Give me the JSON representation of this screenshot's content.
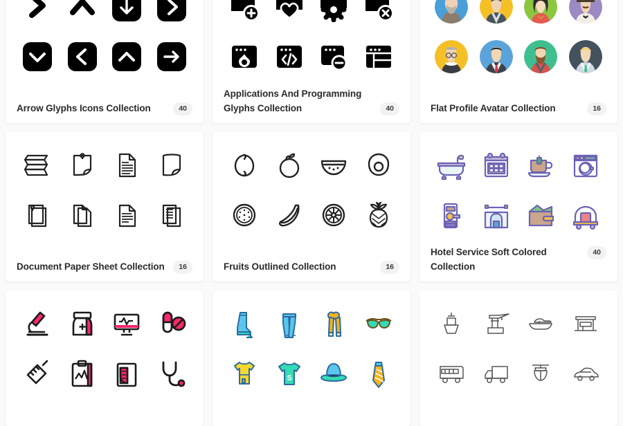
{
  "page": {
    "background_color": "#fafafa",
    "card_color": "#ffffff",
    "title_color": "#2b2b2b",
    "badge_bg": "#f2f2f2"
  },
  "cards": [
    {
      "id": "arrow-glyphs",
      "title": "Arrow Glyphs Icons Collection",
      "count": "40",
      "style": "glyph-black",
      "accent": "#000000",
      "icons": [
        "chevron-right-bold-icon",
        "chevron-up-bold-icon",
        "arrow-down-square-icon",
        "chevron-right-square-icon",
        "chevron-down-square-icon",
        "chevron-left-square-icon",
        "chevron-up-square-icon",
        "arrow-right-square-icon"
      ]
    },
    {
      "id": "applications-programming-glyphs",
      "title": "Applications And Programming Glyphs Collection",
      "count": "40",
      "style": "glyph-black",
      "accent": "#000000",
      "icons": [
        "window-add-icon",
        "window-heart-icon",
        "window-gear-icon",
        "window-close-icon",
        "browser-flame-icon",
        "browser-code-icon",
        "browser-minus-icon",
        "browser-layout-icon"
      ]
    },
    {
      "id": "flat-profile-avatar",
      "title": "Flat Profile Avatar Collection",
      "count": "16",
      "style": "flat-avatar",
      "icons": [
        "avatar-bearded-man-icon",
        "avatar-man-jacket-icon",
        "avatar-woman-dark-hair-icon",
        "avatar-hipster-moustache-icon",
        "avatar-elderly-woman-glasses-icon",
        "avatar-businessman-tie-icon",
        "avatar-beard-red-shirt-icon",
        "avatar-blond-man-green-tie-icon"
      ],
      "avatar_colors": [
        "#4a9fd8",
        "#f5c026",
        "#8cc63f",
        "#9b8ac4",
        "#f5c026",
        "#5ba4db",
        "#3fbf8f",
        "#44525e"
      ]
    },
    {
      "id": "document-paper-sheet",
      "title": "Document Paper Sheet Collection",
      "count": "16",
      "style": "outline-black",
      "accent": "#222222",
      "icons": [
        "folded-paper-icon",
        "pinned-note-curl-icon",
        "text-document-icon",
        "curled-sheet-icon",
        "pinned-sheet-stack-icon",
        "folded-corner-sheet-icon",
        "document-lines-icon",
        "document-stack-lines-icon"
      ]
    },
    {
      "id": "fruits-outlined",
      "title": "Fruits Outlined Collection",
      "count": "16",
      "style": "outline-black",
      "accent": "#222222",
      "icons": [
        "lemon-icon",
        "apple-icon",
        "watermelon-slice-icon",
        "avocado-icon",
        "kiwi-slice-icon",
        "banana-icon",
        "orange-slice-icon",
        "pineapple-icon"
      ]
    },
    {
      "id": "hotel-service-soft-colored",
      "title": "Hotel Service Soft Colored Collection",
      "count": "40",
      "style": "soft-colored",
      "accent": "#6c63b5",
      "icons": [
        "bathtub-icon",
        "calendar-icon",
        "tea-cup-icon",
        "washing-machine-icon",
        "door-lock-icon",
        "hotel-entrance-icon",
        "wallet-icon",
        "luggage-trolley-icon"
      ]
    },
    {
      "id": "medical-pink",
      "title": "",
      "count": "",
      "style": "pink-outline",
      "accent": "#f8296b",
      "icons": [
        "microscope-icon",
        "medicine-bottle-icon",
        "heartbeat-monitor-icon",
        "pills-icon",
        "syringe-icon",
        "medical-clipboard-icon",
        "blood-bag-icon",
        "stethoscope-icon"
      ]
    },
    {
      "id": "clothing-colored",
      "title": "",
      "count": "",
      "style": "clothing-colored",
      "accent": "#29a7df",
      "icons": [
        "high-boot-icon",
        "jeans-icon",
        "scarf-icon",
        "sunglasses-icon",
        "baby-dress-icon",
        "tshirt-icon",
        "hat-icon",
        "necktie-icon"
      ]
    },
    {
      "id": "transport-outline",
      "title": "",
      "count": "",
      "style": "outline-thin",
      "accent": "#555555",
      "icons": [
        "ship-icon",
        "port-crane-icon",
        "speedboat-icon",
        "terminal-building-icon",
        "bus-icon",
        "delivery-truck-icon",
        "cable-car-icon",
        "car-icon"
      ]
    }
  ]
}
